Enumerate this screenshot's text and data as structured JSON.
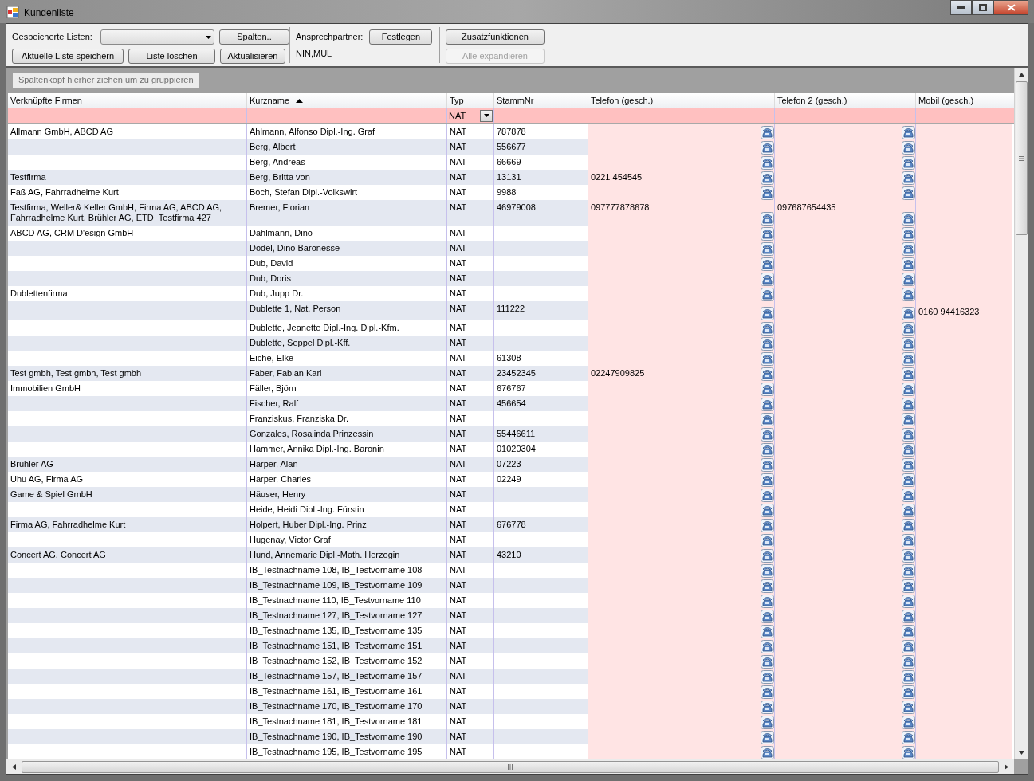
{
  "window": {
    "title": "Kundenliste"
  },
  "toolbar": {
    "saved_lists_label": "Gespeicherte Listen:",
    "columns_button": "Spalten..",
    "save_button": "Aktuelle Liste speichern",
    "delete_button": "Liste löschen",
    "refresh_button": "Aktualisieren",
    "contact_label": "Ansprechpartner:",
    "set_button": "Festlegen",
    "contact_value": "NIN,MUL",
    "functions_button": "Zusatzfunktionen",
    "expand_button": {
      "label": "Alle expandieren",
      "disabled": true
    }
  },
  "group_panel": {
    "hint": "Spaltenkopf hierher ziehen um zu gruppieren"
  },
  "table": {
    "columns": [
      {
        "label": "Verknüpfte Firmen",
        "sorted": false
      },
      {
        "label": "Kurzname",
        "sorted": true
      },
      {
        "label": "Typ",
        "sorted": false
      },
      {
        "label": "StammNr",
        "sorted": false
      },
      {
        "label": "Telefon (gesch.)",
        "sorted": false
      },
      {
        "label": "Telefon 2 (gesch.)",
        "sorted": false
      },
      {
        "label": "Mobil (gesch.)",
        "sorted": false
      }
    ],
    "filter_row": {
      "typ": "NAT"
    },
    "rows": [
      {
        "firmen": "Allmann GmbH, ABCD AG",
        "kurzname": "Ahlmann, Alfonso Dipl.-Ing. Graf",
        "typ": "NAT",
        "stammnr": "787878"
      },
      {
        "kurzname": "Berg, Albert",
        "typ": "NAT",
        "stammnr": "556677"
      },
      {
        "kurzname": "Berg, Andreas",
        "typ": "NAT",
        "stammnr": "66669"
      },
      {
        "firmen": "Testfirma",
        "kurzname": "Berg, Britta von",
        "typ": "NAT",
        "stammnr": "13131",
        "telefon": "0221 454545"
      },
      {
        "firmen": "Faß AG, Fahrradhelme Kurt",
        "kurzname": "Boch, Stefan Dipl.-Volkswirt",
        "typ": "NAT",
        "stammnr": "9988"
      },
      {
        "firmen": "Testfirma, Weller& Keller GmbH, Firma AG, ABCD AG, Fahrradhelme Kurt, Brühler AG, ETD_Testfirma 427",
        "kurzname": "Bremer, Florian",
        "typ": "NAT",
        "stammnr": "46979008",
        "telefon": "097777878678",
        "telefon_2": "097687654435"
      },
      {
        "firmen": "ABCD AG, CRM D'esign GmbH",
        "kurzname": "Dahlmann, Dino",
        "typ": "NAT"
      },
      {
        "kurzname": "Dödel, Dino Baronesse",
        "typ": "NAT"
      },
      {
        "kurzname": "Dub, David",
        "typ": "NAT"
      },
      {
        "kurzname": "Dub, Doris",
        "typ": "NAT"
      },
      {
        "firmen": "Dublettenfirma",
        "kurzname": "Dub, Jupp Dr.",
        "typ": "NAT"
      },
      {
        "kurzname": "Dublette 1, Nat. Person",
        "typ": "NAT",
        "stammnr": "111222",
        "mobil": "0160 94416323"
      },
      {
        "kurzname": "Dublette, Jeanette Dipl.-Ing. Dipl.-Kfm.",
        "typ": "NAT"
      },
      {
        "kurzname": "Dublette, Seppel Dipl.-Kff.",
        "typ": "NAT"
      },
      {
        "kurzname": "Eiche, Elke",
        "typ": "NAT",
        "stammnr": "61308"
      },
      {
        "firmen": "Test gmbh, Test gmbh, Test gmbh",
        "kurzname": "Faber, Fabian Karl",
        "typ": "NAT",
        "stammnr": "23452345",
        "telefon": "02247909825"
      },
      {
        "firmen": "Immobilien GmbH",
        "kurzname": "Fäller, Björn",
        "typ": "NAT",
        "stammnr": "676767"
      },
      {
        "kurzname": "Fischer, Ralf",
        "typ": "NAT",
        "stammnr": "456654"
      },
      {
        "kurzname": "Franziskus, Franziska Dr.",
        "typ": "NAT"
      },
      {
        "kurzname": "Gonzales, Rosalinda Prinzessin",
        "typ": "NAT",
        "stammnr": "55446611"
      },
      {
        "kurzname": "Hammer, Annika Dipl.-Ing. Baronin",
        "typ": "NAT",
        "stammnr": "01020304"
      },
      {
        "firmen": "Brühler AG",
        "kurzname": "Harper, Alan",
        "typ": "NAT",
        "stammnr": "07223"
      },
      {
        "firmen": "Uhu AG, Firma AG",
        "kurzname": "Harper, Charles",
        "typ": "NAT",
        "stammnr": "02249"
      },
      {
        "firmen": "Game & Spiel GmbH",
        "kurzname": "Häuser, Henry",
        "typ": "NAT"
      },
      {
        "kurzname": "Heide, Heidi Dipl.-Ing. Fürstin",
        "typ": "NAT"
      },
      {
        "firmen": "Firma AG, Fahrradhelme Kurt",
        "kurzname": "Holpert, Huber Dipl.-Ing. Prinz",
        "typ": "NAT",
        "stammnr": "676778"
      },
      {
        "kurzname": "Hugenay, Victor Graf",
        "typ": "NAT"
      },
      {
        "firmen": "Concert AG, Concert AG",
        "kurzname": "Hund, Annemarie Dipl.-Math. Herzogin",
        "typ": "NAT",
        "stammnr": "43210"
      },
      {
        "kurzname": "IB_Testnachname 108, IB_Testvorname 108",
        "typ": "NAT"
      },
      {
        "kurzname": "IB_Testnachname 109, IB_Testvorname 109",
        "typ": "NAT"
      },
      {
        "kurzname": "IB_Testnachname 110, IB_Testvorname 110",
        "typ": "NAT"
      },
      {
        "kurzname": "IB_Testnachname 127, IB_Testvorname 127",
        "typ": "NAT"
      },
      {
        "kurzname": "IB_Testnachname 135, IB_Testvorname 135",
        "typ": "NAT"
      },
      {
        "kurzname": "IB_Testnachname 151, IB_Testvorname 151",
        "typ": "NAT"
      },
      {
        "kurzname": "IB_Testnachname 152, IB_Testvorname 152",
        "typ": "NAT"
      },
      {
        "kurzname": "IB_Testnachname 157, IB_Testvorname 157",
        "typ": "NAT"
      },
      {
        "kurzname": "IB_Testnachname 161, IB_Testvorname 161",
        "typ": "NAT"
      },
      {
        "kurzname": "IB_Testnachname 170, IB_Testvorname 170",
        "typ": "NAT"
      },
      {
        "kurzname": "IB_Testnachname 181, IB_Testvorname 181",
        "typ": "NAT"
      },
      {
        "kurzname": "IB_Testnachname 190, IB_Testvorname 190",
        "typ": "NAT"
      },
      {
        "kurzname": "IB_Testnachname 195, IB_Testvorname 195",
        "typ": "NAT"
      }
    ]
  }
}
